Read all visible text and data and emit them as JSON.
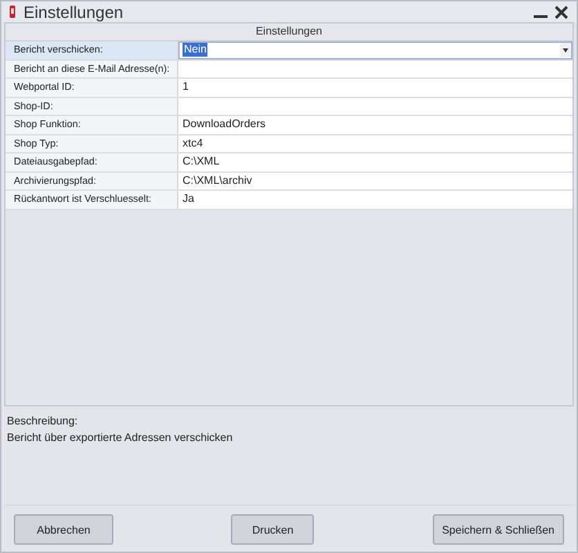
{
  "window": {
    "title": "Einstellungen"
  },
  "grid": {
    "caption": "Einstellungen",
    "rows": [
      {
        "label": "Bericht verschicken:",
        "value": "Nein",
        "kind": "dropdown",
        "selected": true
      },
      {
        "label": "Bericht an diese E-Mail Adresse(n):",
        "value": "",
        "kind": "text",
        "selected": false
      },
      {
        "label": "Webportal ID:",
        "value": "1",
        "kind": "text",
        "selected": false
      },
      {
        "label": "Shop-ID:",
        "value": "",
        "kind": "text",
        "selected": false
      },
      {
        "label": "Shop Funktion:",
        "value": "DownloadOrders",
        "kind": "text",
        "selected": false
      },
      {
        "label": "Shop Typ:",
        "value": "xtc4",
        "kind": "text",
        "selected": false
      },
      {
        "label": "Dateiausgabepfad:",
        "value": "C:\\XML",
        "kind": "text",
        "selected": false
      },
      {
        "label": "Archivierungspfad:",
        "value": "C:\\XML\\archiv",
        "kind": "text",
        "selected": false
      },
      {
        "label": "Rückantwort ist Verschluesselt:",
        "value": "Ja",
        "kind": "text",
        "selected": false
      }
    ]
  },
  "description": {
    "heading": "Beschreibung:",
    "text": "Bericht über exportierte Adressen verschicken"
  },
  "buttons": [
    "Abbrechen",
    "Drucken",
    "Speichern & Schließen"
  ]
}
